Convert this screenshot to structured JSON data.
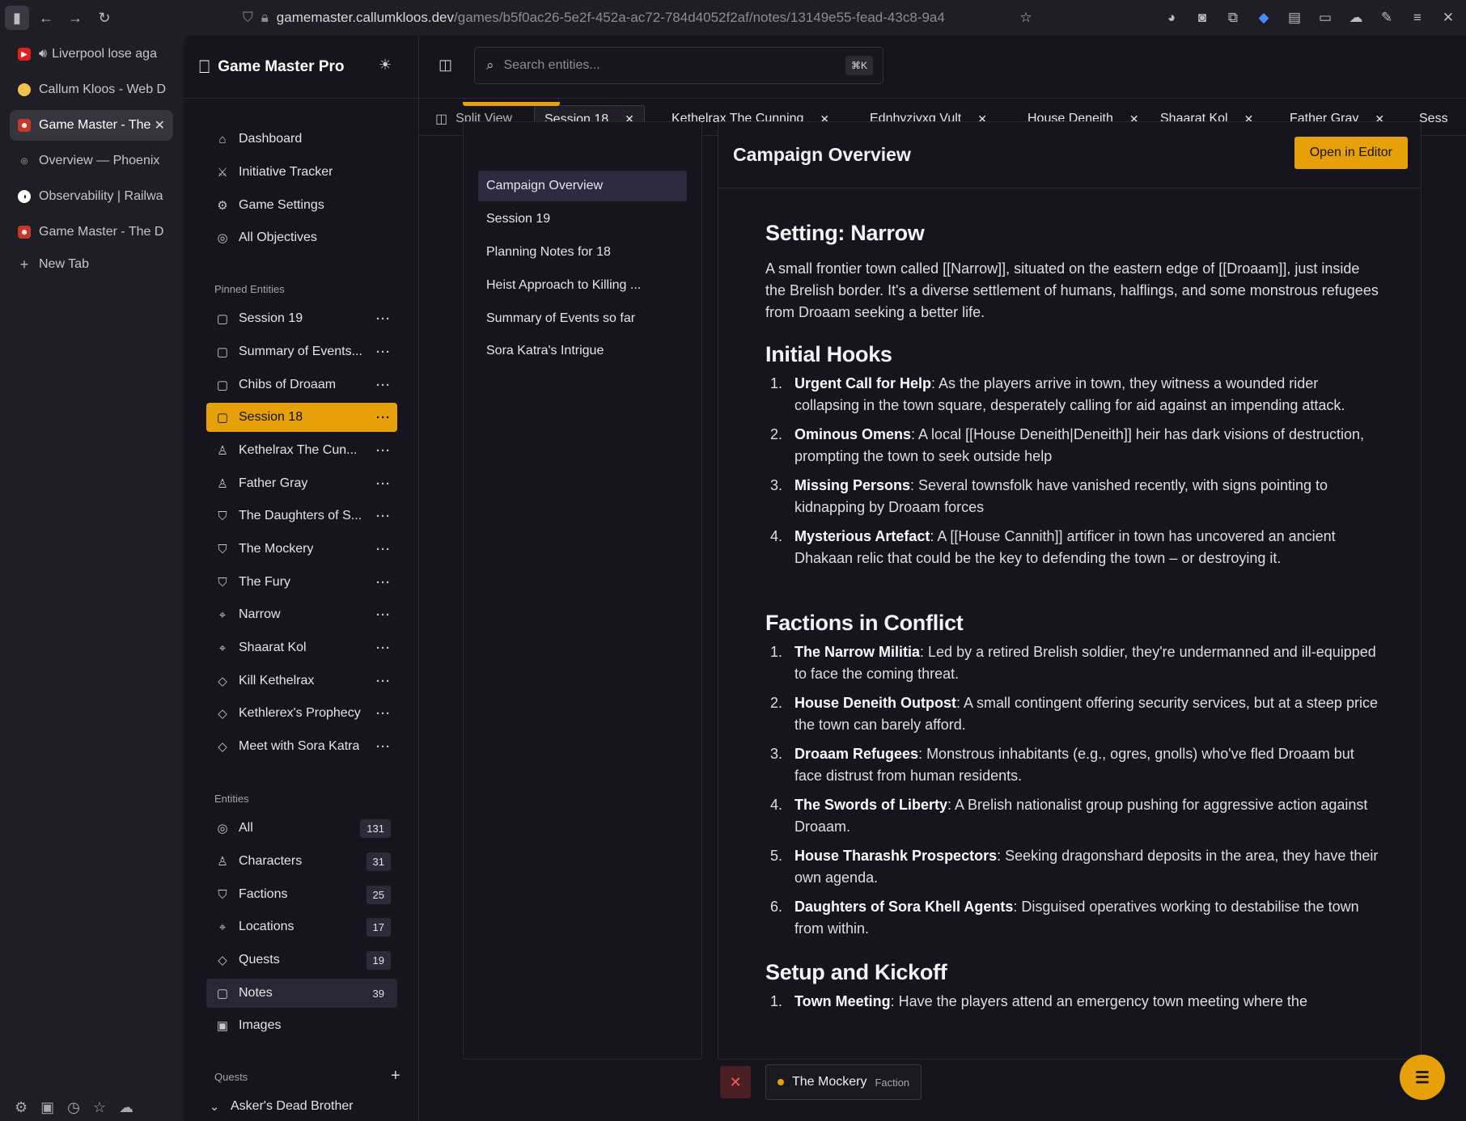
{
  "browser": {
    "url_host": "gamemaster.callumkloos.dev",
    "url_path": "/games/b5f0ac26-5e2f-452a-ac72-784d4052f2af/notes/13149e55-fead-43c8-9a4",
    "tabs": [
      {
        "label": "Liverpool lose aga",
        "icon": "youtube-icon",
        "audio": true
      },
      {
        "label": "Callum Kloos - Web D",
        "icon": "avatar-icon"
      },
      {
        "label": "Game Master - The",
        "icon": "demon-icon",
        "active": true
      },
      {
        "label": "Overview — Phoenix",
        "icon": "globe-icon"
      },
      {
        "label": "Observability | Railwa",
        "icon": "railway-icon"
      },
      {
        "label": "Game Master - The D",
        "icon": "demon-icon"
      }
    ],
    "new_tab_label": "New Tab"
  },
  "app": {
    "name": "Game Master Pro",
    "nav": [
      {
        "label": "Dashboard",
        "icon": "home-icon"
      },
      {
        "label": "Initiative Tracker",
        "icon": "swords-icon"
      },
      {
        "label": "Game Settings",
        "icon": "gear-icon"
      },
      {
        "label": "All Objectives",
        "icon": "target-icon"
      }
    ],
    "pinned_label": "Pinned Entities",
    "pinned": [
      {
        "label": "Session 19",
        "icon": "note-icon"
      },
      {
        "label": "Summary of Events...",
        "icon": "note-icon"
      },
      {
        "label": "Chibs of Droaam",
        "icon": "note-icon"
      },
      {
        "label": "Session 18",
        "icon": "note-icon",
        "selected": true
      },
      {
        "label": "Kethelrax The Cun...",
        "icon": "person-icon"
      },
      {
        "label": "Father Gray",
        "icon": "person-icon"
      },
      {
        "label": "The Daughters of S...",
        "icon": "shield-icon"
      },
      {
        "label": "The Mockery",
        "icon": "shield-icon"
      },
      {
        "label": "The Fury",
        "icon": "shield-icon"
      },
      {
        "label": "Narrow",
        "icon": "pin-icon"
      },
      {
        "label": "Shaarat Kol",
        "icon": "pin-icon"
      },
      {
        "label": "Kill Kethelrax",
        "icon": "gem-icon"
      },
      {
        "label": "Kethlerex's Prophecy",
        "icon": "gem-icon"
      },
      {
        "label": "Meet with Sora Katra",
        "icon": "gem-icon"
      }
    ],
    "entities_label": "Entities",
    "entities": [
      {
        "label": "All",
        "icon": "globe-icon",
        "count": "131"
      },
      {
        "label": "Characters",
        "icon": "people-icon",
        "count": "31"
      },
      {
        "label": "Factions",
        "icon": "shield-icon",
        "count": "25"
      },
      {
        "label": "Locations",
        "icon": "pin-icon",
        "count": "17"
      },
      {
        "label": "Quests",
        "icon": "gem-icon",
        "count": "19"
      },
      {
        "label": "Notes",
        "icon": "note-icon",
        "count": "39",
        "highlighted": true
      },
      {
        "label": "Images",
        "icon": "image-icon",
        "count": ""
      }
    ],
    "quests_label": "Quests",
    "quest_group": "Asker's Dead Brother"
  },
  "search": {
    "placeholder": "Search entities...",
    "shortcut": "⌘K"
  },
  "tabs": [
    {
      "label": "Split View",
      "type": "split"
    },
    {
      "label": "Session 18",
      "active": true
    },
    {
      "label": "Kethelrax The Cunning"
    },
    {
      "label": "Ednhyzjyxg Vult"
    },
    {
      "label": "House Deneith"
    },
    {
      "label": "Shaarat Kol"
    },
    {
      "label": "Father Gray"
    },
    {
      "label": "Sess"
    }
  ],
  "notes_list": [
    {
      "label": "Campaign Overview",
      "active": true
    },
    {
      "label": "Session 19"
    },
    {
      "label": "Planning Notes for 18"
    },
    {
      "label": "Heist Approach to Killing ..."
    },
    {
      "label": "Summary of Events so far"
    },
    {
      "label": "Sora Katra's Intrigue"
    }
  ],
  "document": {
    "title": "Campaign Overview",
    "open_editor_label": "Open in Editor",
    "setting_heading": "Setting: Narrow",
    "setting_text": "A small frontier town called [[Narrow]], situated on the eastern edge of [[Droaam]], just inside the Brelish border. It's a diverse settlement of humans, halflings, and some monstrous refugees from Droaam seeking a better life.",
    "hooks_heading": "Initial Hooks",
    "hooks": [
      {
        "title": "Urgent Call for Help",
        "text": ": As the players arrive in town, they witness a wounded rider collapsing in the town square, desperately calling for aid against an impending attack."
      },
      {
        "title": "Ominous Omens",
        "text": ": A local [[House Deneith|Deneith]] heir has dark visions of destruction, prompting the town to seek outside help"
      },
      {
        "title": "Missing Persons",
        "text": ": Several townsfolk have vanished recently, with signs pointing to kidnapping by Droaam forces"
      },
      {
        "title": "Mysterious Artefact",
        "text": ": A [[House Cannith]] artificer in town has uncovered an ancient Dhakaan relic that could be the key to defending the town – or destroying it."
      }
    ],
    "factions_heading": "Factions in Conflict",
    "factions": [
      {
        "title": "The Narrow Militia",
        "text": ": Led by a retired Brelish soldier, they're undermanned and ill-equipped to face the coming threat."
      },
      {
        "title": "House Deneith Outpost",
        "text": ": A small contingent offering security services, but at a steep price the town can barely afford."
      },
      {
        "title": "Droaam Refugees",
        "text": ": Monstrous inhabitants (e.g., ogres, gnolls) who've fled Droaam but face distrust from human residents."
      },
      {
        "title": "The Swords of Liberty",
        "text": ": A Brelish nationalist group pushing for aggressive action against Droaam."
      },
      {
        "title": "House Tharashk Prospectors",
        "text": ": Seeking dragonshard deposits in the area, they have their own agenda."
      },
      {
        "title": "Daughters of Sora Khell Agents",
        "text": ": Disguised operatives working to destabilise the town from within."
      }
    ],
    "setup_heading": "Setup and Kickoff",
    "setup": [
      {
        "title": "Town Meeting",
        "text": ": Have the players attend an emergency town meeting where the"
      }
    ]
  },
  "bottom": {
    "chip_label": "The Mockery",
    "chip_kind": "Faction"
  }
}
